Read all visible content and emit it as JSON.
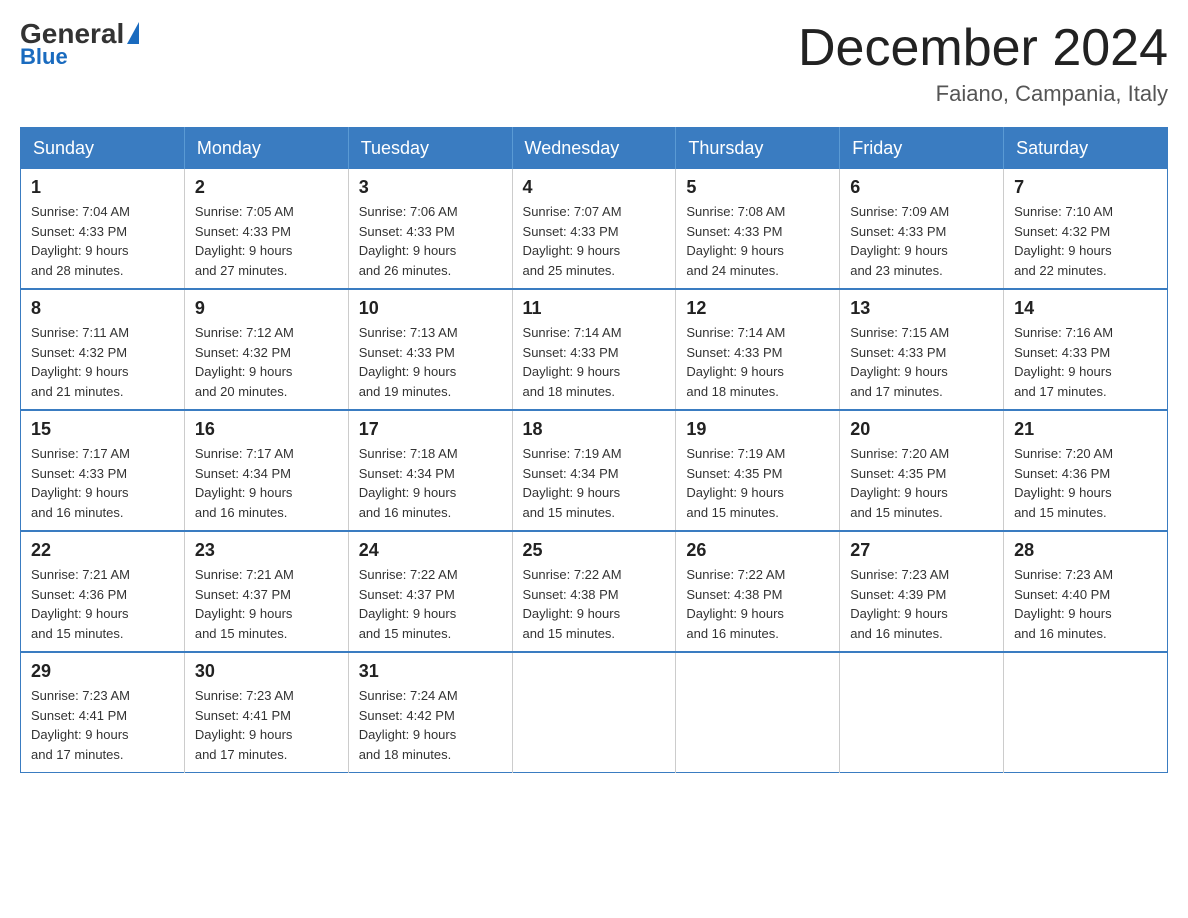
{
  "header": {
    "logo_general": "General",
    "logo_blue": "Blue",
    "title": "December 2024",
    "location": "Faiano, Campania, Italy"
  },
  "days_of_week": [
    "Sunday",
    "Monday",
    "Tuesday",
    "Wednesday",
    "Thursday",
    "Friday",
    "Saturday"
  ],
  "weeks": [
    [
      {
        "day": "1",
        "sunrise": "7:04 AM",
        "sunset": "4:33 PM",
        "daylight": "9 hours and 28 minutes."
      },
      {
        "day": "2",
        "sunrise": "7:05 AM",
        "sunset": "4:33 PM",
        "daylight": "9 hours and 27 minutes."
      },
      {
        "day": "3",
        "sunrise": "7:06 AM",
        "sunset": "4:33 PM",
        "daylight": "9 hours and 26 minutes."
      },
      {
        "day": "4",
        "sunrise": "7:07 AM",
        "sunset": "4:33 PM",
        "daylight": "9 hours and 25 minutes."
      },
      {
        "day": "5",
        "sunrise": "7:08 AM",
        "sunset": "4:33 PM",
        "daylight": "9 hours and 24 minutes."
      },
      {
        "day": "6",
        "sunrise": "7:09 AM",
        "sunset": "4:33 PM",
        "daylight": "9 hours and 23 minutes."
      },
      {
        "day": "7",
        "sunrise": "7:10 AM",
        "sunset": "4:32 PM",
        "daylight": "9 hours and 22 minutes."
      }
    ],
    [
      {
        "day": "8",
        "sunrise": "7:11 AM",
        "sunset": "4:32 PM",
        "daylight": "9 hours and 21 minutes."
      },
      {
        "day": "9",
        "sunrise": "7:12 AM",
        "sunset": "4:32 PM",
        "daylight": "9 hours and 20 minutes."
      },
      {
        "day": "10",
        "sunrise": "7:13 AM",
        "sunset": "4:33 PM",
        "daylight": "9 hours and 19 minutes."
      },
      {
        "day": "11",
        "sunrise": "7:14 AM",
        "sunset": "4:33 PM",
        "daylight": "9 hours and 18 minutes."
      },
      {
        "day": "12",
        "sunrise": "7:14 AM",
        "sunset": "4:33 PM",
        "daylight": "9 hours and 18 minutes."
      },
      {
        "day": "13",
        "sunrise": "7:15 AM",
        "sunset": "4:33 PM",
        "daylight": "9 hours and 17 minutes."
      },
      {
        "day": "14",
        "sunrise": "7:16 AM",
        "sunset": "4:33 PM",
        "daylight": "9 hours and 17 minutes."
      }
    ],
    [
      {
        "day": "15",
        "sunrise": "7:17 AM",
        "sunset": "4:33 PM",
        "daylight": "9 hours and 16 minutes."
      },
      {
        "day": "16",
        "sunrise": "7:17 AM",
        "sunset": "4:34 PM",
        "daylight": "9 hours and 16 minutes."
      },
      {
        "day": "17",
        "sunrise": "7:18 AM",
        "sunset": "4:34 PM",
        "daylight": "9 hours and 16 minutes."
      },
      {
        "day": "18",
        "sunrise": "7:19 AM",
        "sunset": "4:34 PM",
        "daylight": "9 hours and 15 minutes."
      },
      {
        "day": "19",
        "sunrise": "7:19 AM",
        "sunset": "4:35 PM",
        "daylight": "9 hours and 15 minutes."
      },
      {
        "day": "20",
        "sunrise": "7:20 AM",
        "sunset": "4:35 PM",
        "daylight": "9 hours and 15 minutes."
      },
      {
        "day": "21",
        "sunrise": "7:20 AM",
        "sunset": "4:36 PM",
        "daylight": "9 hours and 15 minutes."
      }
    ],
    [
      {
        "day": "22",
        "sunrise": "7:21 AM",
        "sunset": "4:36 PM",
        "daylight": "9 hours and 15 minutes."
      },
      {
        "day": "23",
        "sunrise": "7:21 AM",
        "sunset": "4:37 PM",
        "daylight": "9 hours and 15 minutes."
      },
      {
        "day": "24",
        "sunrise": "7:22 AM",
        "sunset": "4:37 PM",
        "daylight": "9 hours and 15 minutes."
      },
      {
        "day": "25",
        "sunrise": "7:22 AM",
        "sunset": "4:38 PM",
        "daylight": "9 hours and 15 minutes."
      },
      {
        "day": "26",
        "sunrise": "7:22 AM",
        "sunset": "4:38 PM",
        "daylight": "9 hours and 16 minutes."
      },
      {
        "day": "27",
        "sunrise": "7:23 AM",
        "sunset": "4:39 PM",
        "daylight": "9 hours and 16 minutes."
      },
      {
        "day": "28",
        "sunrise": "7:23 AM",
        "sunset": "4:40 PM",
        "daylight": "9 hours and 16 minutes."
      }
    ],
    [
      {
        "day": "29",
        "sunrise": "7:23 AM",
        "sunset": "4:41 PM",
        "daylight": "9 hours and 17 minutes."
      },
      {
        "day": "30",
        "sunrise": "7:23 AM",
        "sunset": "4:41 PM",
        "daylight": "9 hours and 17 minutes."
      },
      {
        "day": "31",
        "sunrise": "7:24 AM",
        "sunset": "4:42 PM",
        "daylight": "9 hours and 18 minutes."
      },
      null,
      null,
      null,
      null
    ]
  ],
  "labels": {
    "sunrise": "Sunrise:",
    "sunset": "Sunset:",
    "daylight": "Daylight:"
  }
}
